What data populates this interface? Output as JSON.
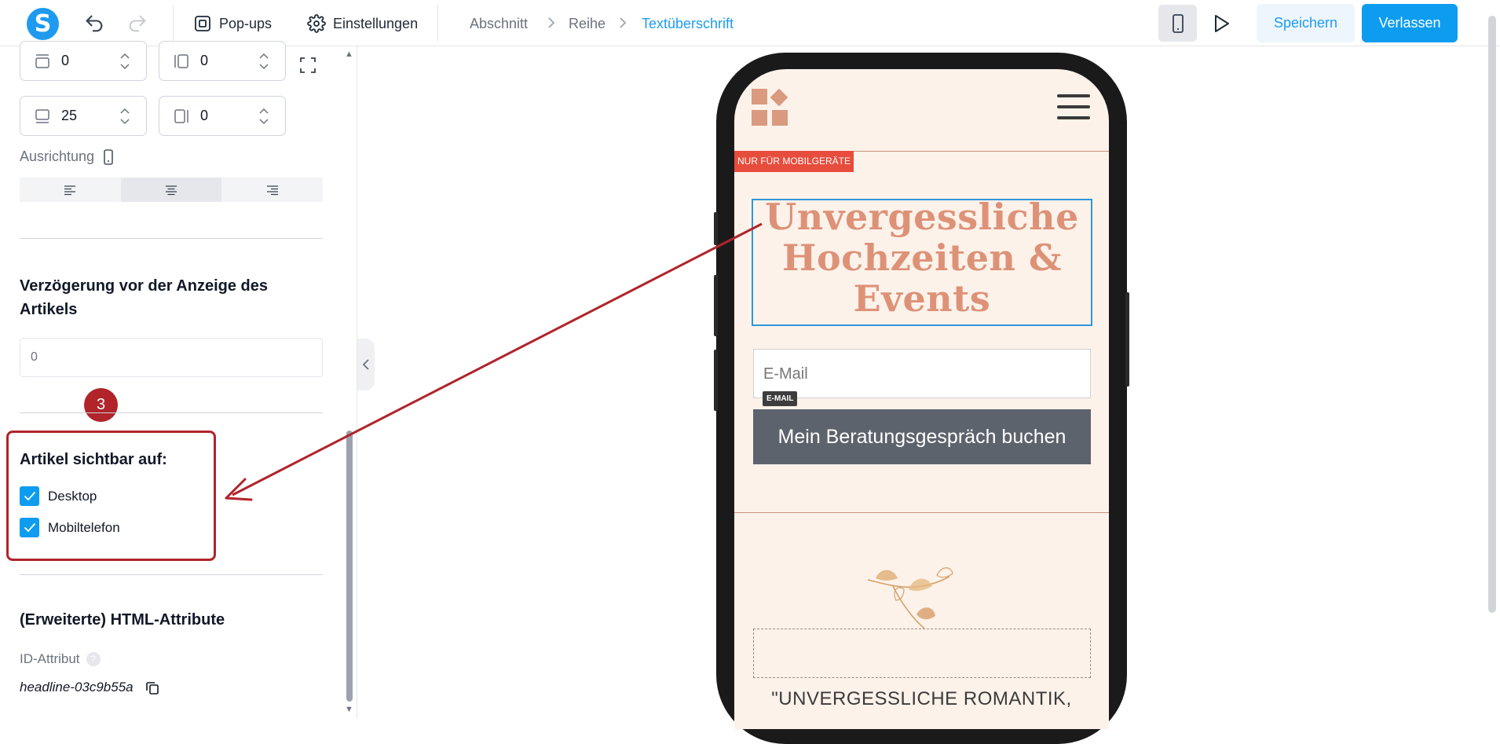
{
  "colors": {
    "accent": "#1e9bf0",
    "primary_button": "#0d9cf0",
    "annotation_red": "#b0242a",
    "headline_color": "#dd9278",
    "cta_bg": "#5d636d",
    "preview_bg": "#fdf2ea"
  },
  "topbar": {
    "logo_letter": "S",
    "undo_icon": "undo-icon",
    "redo_icon": "redo-icon",
    "popups_label": "Pop-ups",
    "settings_label": "Einstellungen",
    "breadcrumb": [
      "Abschnitt",
      "Reihe",
      "Textüberschrift"
    ],
    "save_label": "Speichern",
    "leave_label": "Verlassen"
  },
  "panel": {
    "spacing_fields": [
      {
        "icon": "padding-top-icon",
        "value": "0"
      },
      {
        "icon": "padding-left-icon",
        "value": "0"
      },
      {
        "icon": "padding-bottom-icon",
        "value": "25"
      },
      {
        "icon": "padding-right-icon",
        "value": "0"
      }
    ],
    "alignment_label": "Ausrichtung",
    "alignment_selected": "center",
    "delay_title": "Verzögerung vor der Anzeige des Artikels",
    "delay_value": "0",
    "step_badge": "3",
    "visibility_title": "Artikel sichtbar auf:",
    "visibility_options": [
      {
        "label": "Desktop",
        "checked": true
      },
      {
        "label": "Mobiltelefon",
        "checked": true
      }
    ],
    "html_attrs_title": "(Erweiterte) HTML-Attribute",
    "id_label": "ID-Attribut",
    "id_help": "?",
    "id_value": "headline-03c9b55a"
  },
  "preview": {
    "mobile_only_badge": "NUR FÜR MOBILGERÄTE",
    "headline": "Unvergessliche Hochzeiten & Events",
    "email_placeholder": "E-Mail",
    "email_tag": "E-MAIL",
    "cta_label": "Mein Beratungsgespräch buchen",
    "quote_text": "\"UNVERGESSLICHE ROMANTIK,"
  }
}
